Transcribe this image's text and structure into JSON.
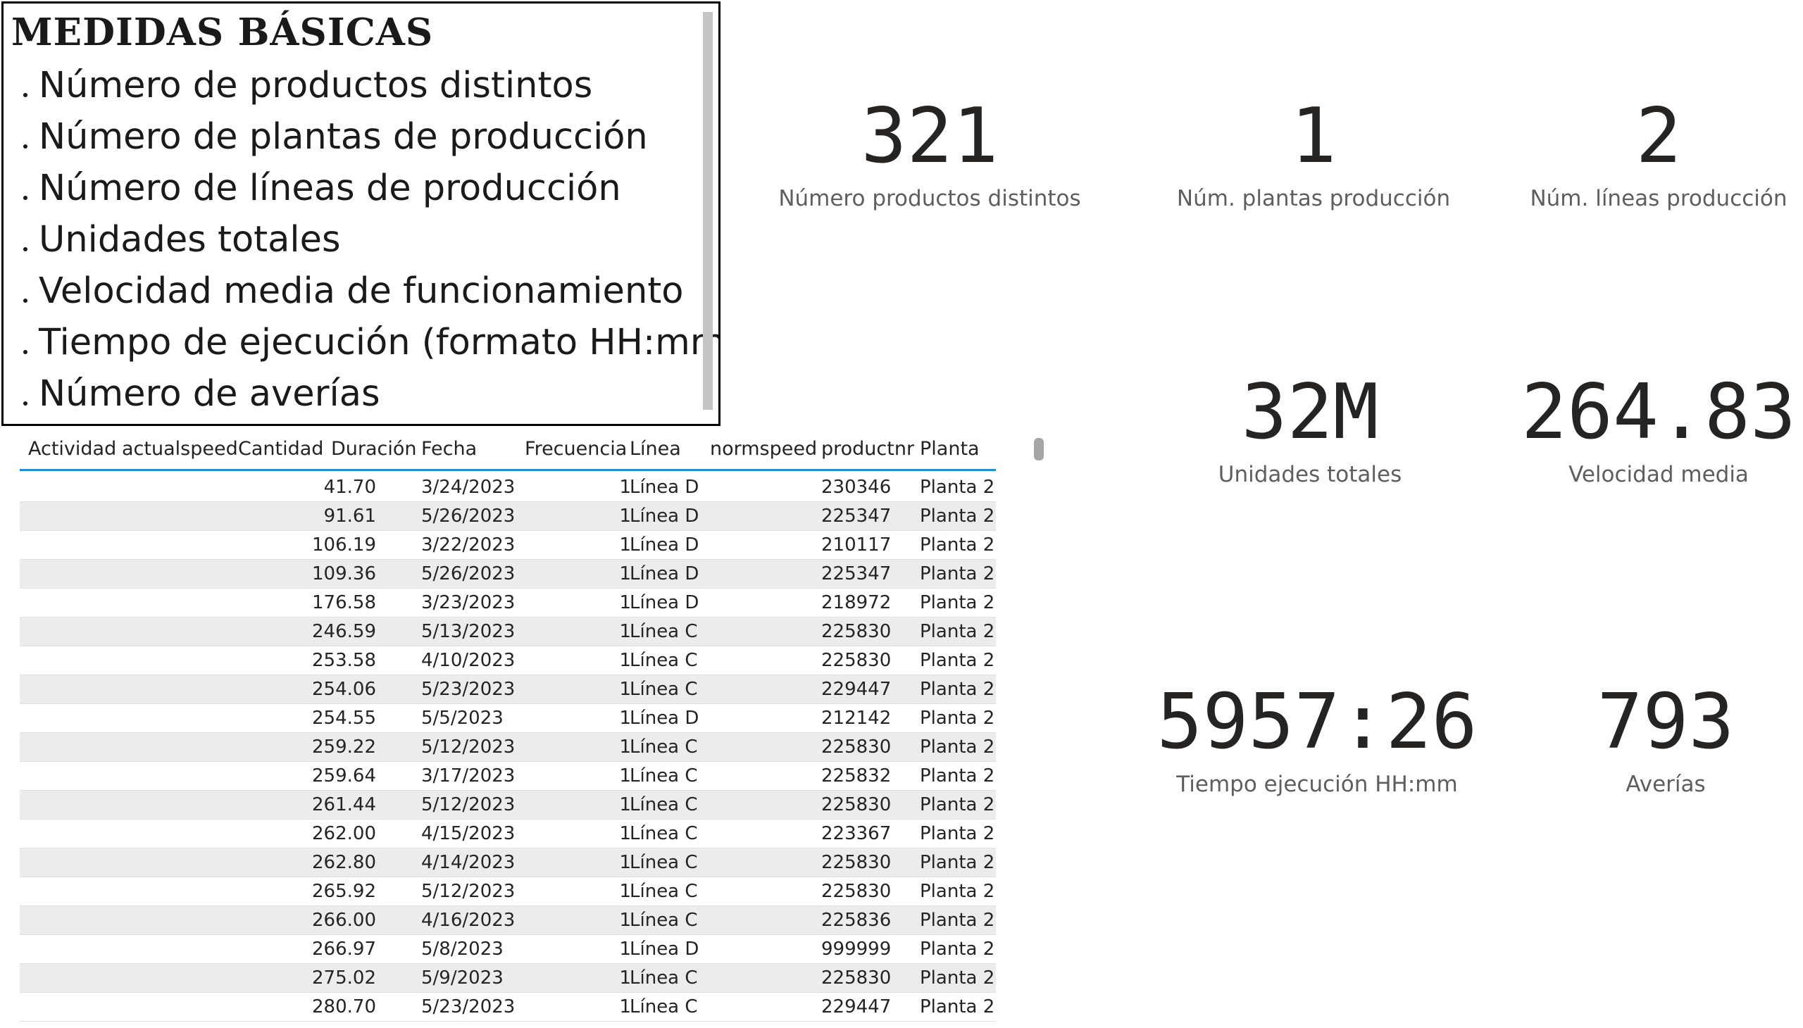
{
  "textbox": {
    "title": "MEDIDAS BÁSICAS",
    "items": [
      "Número de productos distintos",
      "Número de plantas de producción",
      "Número de líneas de producción",
      "Unidades totales",
      "Velocidad media de funcionamiento",
      "Tiempo de ejecución (formato HH:mm)",
      "Número de averías"
    ]
  },
  "cards": {
    "productos": {
      "value": "321",
      "label": "Número productos distintos"
    },
    "plantas": {
      "value": "1",
      "label": "Núm. plantas producción"
    },
    "lineas": {
      "value": "2",
      "label": "Núm. líneas producción"
    },
    "unidades": {
      "value": "32M",
      "label": "Unidades totales"
    },
    "velocidad": {
      "value": "264.83",
      "label": "Velocidad media"
    },
    "tiempo": {
      "value": "5957:26",
      "label": "Tiempo ejecución HH:mm"
    },
    "averias": {
      "value": "793",
      "label": "Averías"
    }
  },
  "table": {
    "columns": [
      "Actividad",
      "actualspeed",
      "Cantidad",
      "Duración",
      "Fecha",
      "Frecuencia",
      "Línea",
      "normspeed",
      "productnr",
      "Planta"
    ],
    "rows": [
      [
        "",
        "",
        "",
        "41.70",
        "3/24/2023",
        "1",
        "Línea D",
        "",
        "230346",
        "Planta 2"
      ],
      [
        "",
        "",
        "",
        "91.61",
        "5/26/2023",
        "1",
        "Línea D",
        "",
        "225347",
        "Planta 2"
      ],
      [
        "",
        "",
        "",
        "106.19",
        "3/22/2023",
        "1",
        "Línea D",
        "",
        "210117",
        "Planta 2"
      ],
      [
        "",
        "",
        "",
        "109.36",
        "5/26/2023",
        "1",
        "Línea D",
        "",
        "225347",
        "Planta 2"
      ],
      [
        "",
        "",
        "",
        "176.58",
        "3/23/2023",
        "1",
        "Línea D",
        "",
        "218972",
        "Planta 2"
      ],
      [
        "",
        "",
        "",
        "246.59",
        "5/13/2023",
        "1",
        "Línea C",
        "",
        "225830",
        "Planta 2"
      ],
      [
        "",
        "",
        "",
        "253.58",
        "4/10/2023",
        "1",
        "Línea C",
        "",
        "225830",
        "Planta 2"
      ],
      [
        "",
        "",
        "",
        "254.06",
        "5/23/2023",
        "1",
        "Línea C",
        "",
        "229447",
        "Planta 2"
      ],
      [
        "",
        "",
        "",
        "254.55",
        "5/5/2023",
        "1",
        "Línea D",
        "",
        "212142",
        "Planta 2"
      ],
      [
        "",
        "",
        "",
        "259.22",
        "5/12/2023",
        "1",
        "Línea C",
        "",
        "225830",
        "Planta 2"
      ],
      [
        "",
        "",
        "",
        "259.64",
        "3/17/2023",
        "1",
        "Línea C",
        "",
        "225832",
        "Planta 2"
      ],
      [
        "",
        "",
        "",
        "261.44",
        "5/12/2023",
        "1",
        "Línea C",
        "",
        "225830",
        "Planta 2"
      ],
      [
        "",
        "",
        "",
        "262.00",
        "4/15/2023",
        "1",
        "Línea C",
        "",
        "223367",
        "Planta 2"
      ],
      [
        "",
        "",
        "",
        "262.80",
        "4/14/2023",
        "1",
        "Línea C",
        "",
        "225830",
        "Planta 2"
      ],
      [
        "",
        "",
        "",
        "265.92",
        "5/12/2023",
        "1",
        "Línea C",
        "",
        "225830",
        "Planta 2"
      ],
      [
        "",
        "",
        "",
        "266.00",
        "4/16/2023",
        "1",
        "Línea C",
        "",
        "225836",
        "Planta 2"
      ],
      [
        "",
        "",
        "",
        "266.97",
        "5/8/2023",
        "1",
        "Línea D",
        "",
        "999999",
        "Planta 2"
      ],
      [
        "",
        "",
        "",
        "275.02",
        "5/9/2023",
        "1",
        "Línea C",
        "",
        "225830",
        "Planta 2"
      ],
      [
        "",
        "",
        "",
        "280.70",
        "5/23/2023",
        "1",
        "Línea C",
        "",
        "229447",
        "Planta 2"
      ]
    ]
  }
}
